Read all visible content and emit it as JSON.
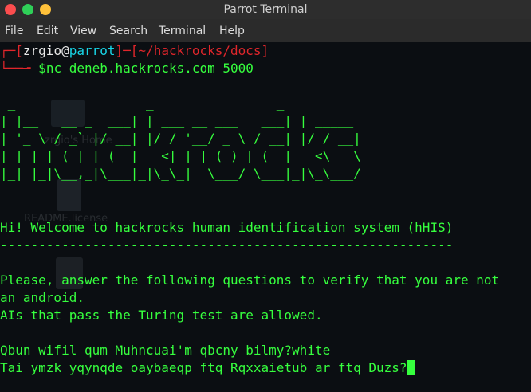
{
  "window": {
    "title": "Parrot Terminal",
    "colors": {
      "close": "#fb4d4e",
      "minimize": "#ffc13a",
      "maximize": "#2fcf58"
    }
  },
  "menubar": {
    "items": [
      "File",
      "Edit",
      "View",
      "Search",
      "Terminal",
      "Help"
    ]
  },
  "desktop_ghosts": {
    "home_label": "zrgio's Home",
    "readme_label": "README.license"
  },
  "prompt": {
    "bracket_open": "┌─[",
    "user": "zrgio",
    "at": "@",
    "host": "parrot",
    "sep": "]─[",
    "path": "~/hackrocks/docs",
    "bracket_close": "]",
    "second_prefix": "└──╼ ",
    "dollar": "$",
    "command": "nc deneb.hackrocks.com 5000"
  },
  "banner": [
    " _                 _                _",
    "| |__   __ _  ___| | ___ __ ___   ___| | _____",
    "| '_ \\ / _` |/ __| |/ / '__/ _ \\ / __| |/ / __|",
    "| | | | (_| | (__|   <| | | (_) | (__|   <\\__ \\",
    "|_| |_|\\__,_|\\___|_|\\_\\_|  \\___/ \\___|_|\\_\\___/"
  ],
  "output": {
    "welcome": "Hi! Welcome to hackrocks human identification system (hHIS)",
    "divider": "-----------------------------------------------------------",
    "question_line1": "Please, answer the following questions to verify that you are not",
    "question_line2": "an android.",
    "ai_notice": "AIs that pass the Turing test are allowed.",
    "q1": "Qbun wifil qum Muhncuai'm qbcny bilmy?white",
    "q2": "Tai ymzk yqynqde oaybaeqp ftq Rqxxaietub ar ftq Duzs?"
  },
  "colors": {
    "text": "#36ff3e",
    "prompt_bracket": "#e0262b",
    "prompt_host": "#18d6e8",
    "background": "#0b0e12"
  }
}
